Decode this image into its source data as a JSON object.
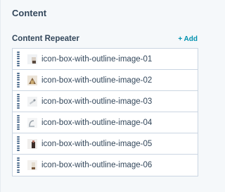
{
  "section": {
    "title": "Content"
  },
  "repeater": {
    "label": "Content Repeater",
    "add_label": "+ Add",
    "items": [
      {
        "label": "icon-box-with-outline-image-01",
        "thumb": "image-thumbnail-icon"
      },
      {
        "label": "icon-box-with-outline-image-02",
        "thumb": "image-thumbnail-icon"
      },
      {
        "label": "icon-box-with-outline-image-03",
        "thumb": "image-thumbnail-icon"
      },
      {
        "label": "icon-box-with-outline-image-04",
        "thumb": "image-thumbnail-icon"
      },
      {
        "label": "icon-box-with-outline-image-05",
        "thumb": "image-thumbnail-icon"
      },
      {
        "label": "icon-box-with-outline-image-06",
        "thumb": "image-thumbnail-icon"
      }
    ]
  },
  "colors": {
    "accent": "#0091ae",
    "text": "#33475b",
    "border": "#cbd6e2",
    "handle": "#516f90"
  }
}
